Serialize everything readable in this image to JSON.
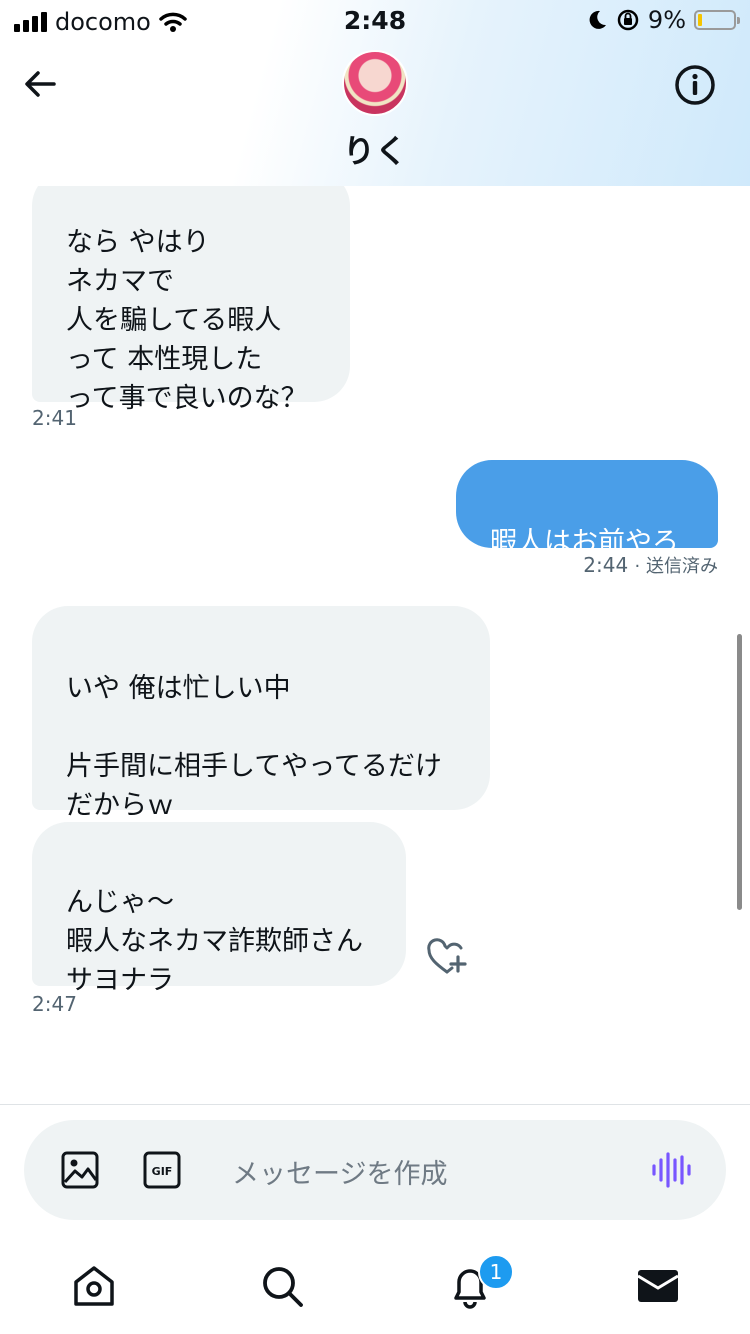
{
  "status_bar": {
    "carrier": "docomo",
    "time": "2:48",
    "battery": "9%",
    "battery_level": 0.09
  },
  "header": {
    "contact_name": "りく",
    "back_icon": "arrow-left-icon",
    "info_icon": "info-circle-icon"
  },
  "messages": [
    {
      "direction": "in",
      "text": "なら やはり\nネカマで\n人を騙してる暇人\nって 本性現した\nって事で良いのな？",
      "time": "2:41"
    },
    {
      "direction": "out",
      "text": "暇人はお前やろ",
      "time": "2:44",
      "status": "· 送信済み"
    },
    {
      "direction": "in",
      "text": "いや 俺は忙しい中\n\n片手間に相手してやってるだけ\nだからｗ"
    },
    {
      "direction": "in",
      "text": "んじゃ〜\n暇人なネカマ詐欺師さん\nサヨナラ",
      "time": "2:47"
    }
  ],
  "composer": {
    "placeholder": "メッセージを作成",
    "image_icon": "image-icon",
    "gif_icon": "gif-icon",
    "voice_icon": "voice-wave-icon"
  },
  "tabbar": {
    "items": [
      "home-icon",
      "search-icon",
      "notifications-icon",
      "messages-icon"
    ],
    "notification_badge": "1"
  },
  "colors": {
    "accent": "#1d9bf0",
    "outgoing_bubble": "#4a9ee8",
    "incoming_bubble": "#eff3f4",
    "voice_icon": "#7856ff"
  }
}
